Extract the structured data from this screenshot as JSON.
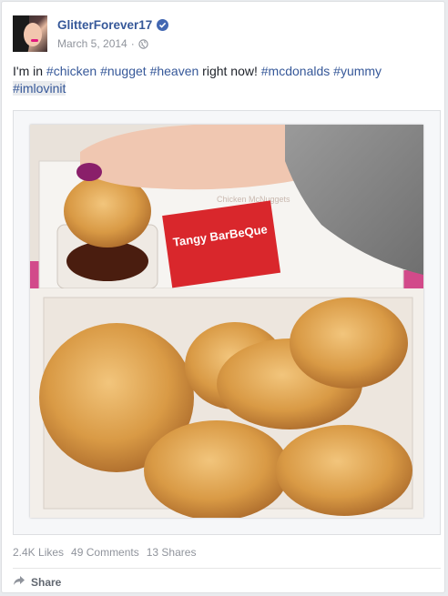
{
  "post": {
    "author": "GlitterForever17",
    "date": "March 5, 2014",
    "text": {
      "prefix": "I'm in ",
      "tag_chicken": "#chicken",
      "tag_nugget": "#nugget",
      "tag_heaven": "#heaven",
      "middle": " right now! ",
      "tag_mcdonalds": "#mcdonalds",
      "tag_yummy": "#yummy",
      "tag_imlovinit": "#imlovinit"
    },
    "photo": {
      "sauce_label": "Tangy BarBeQue",
      "sauce_cup_text": "Chicken McNuggets"
    }
  },
  "stats": {
    "likes": "2.4K Likes",
    "comments": "49 Comments",
    "shares": "13 Shares"
  },
  "actions": {
    "share_label": "Share"
  },
  "colors": {
    "link": "#365899",
    "verified": "#4267b2",
    "muted": "#90949c"
  }
}
